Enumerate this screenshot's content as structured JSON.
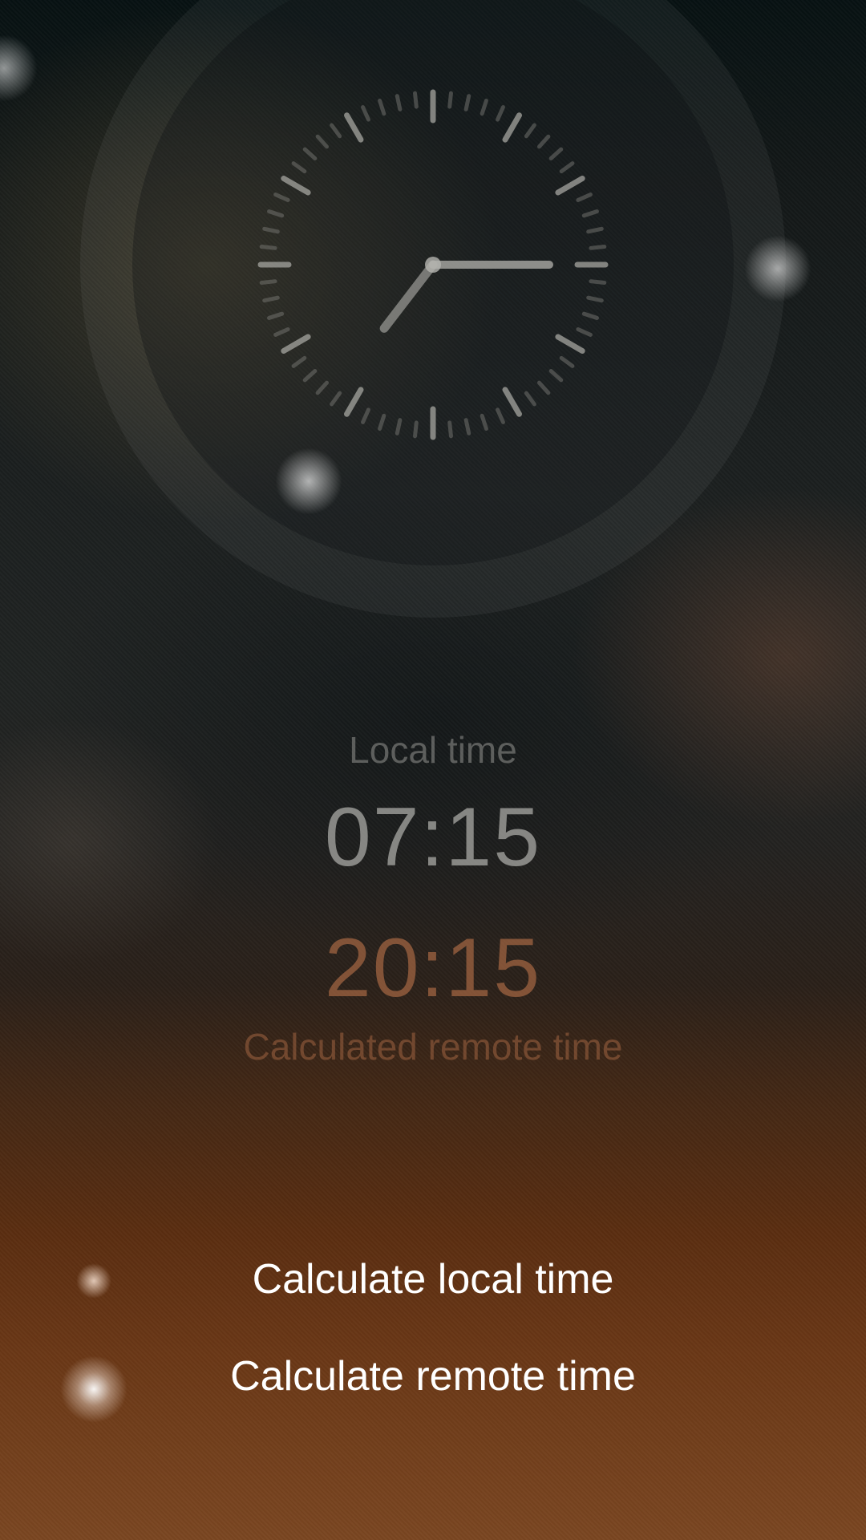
{
  "clock": {
    "hour": 7,
    "minute": 15,
    "icon": "analog-clock"
  },
  "local": {
    "label": "Local time",
    "time": "07:15"
  },
  "remote": {
    "time": "20:15",
    "label": "Calculated remote time"
  },
  "menu": {
    "items": [
      {
        "label": "Calculate local time"
      },
      {
        "label": "Calculate remote time"
      }
    ]
  },
  "colors": {
    "accent": "#a0643f",
    "primary_text": "#ffffff",
    "secondary_text": "#aaaaa5"
  }
}
